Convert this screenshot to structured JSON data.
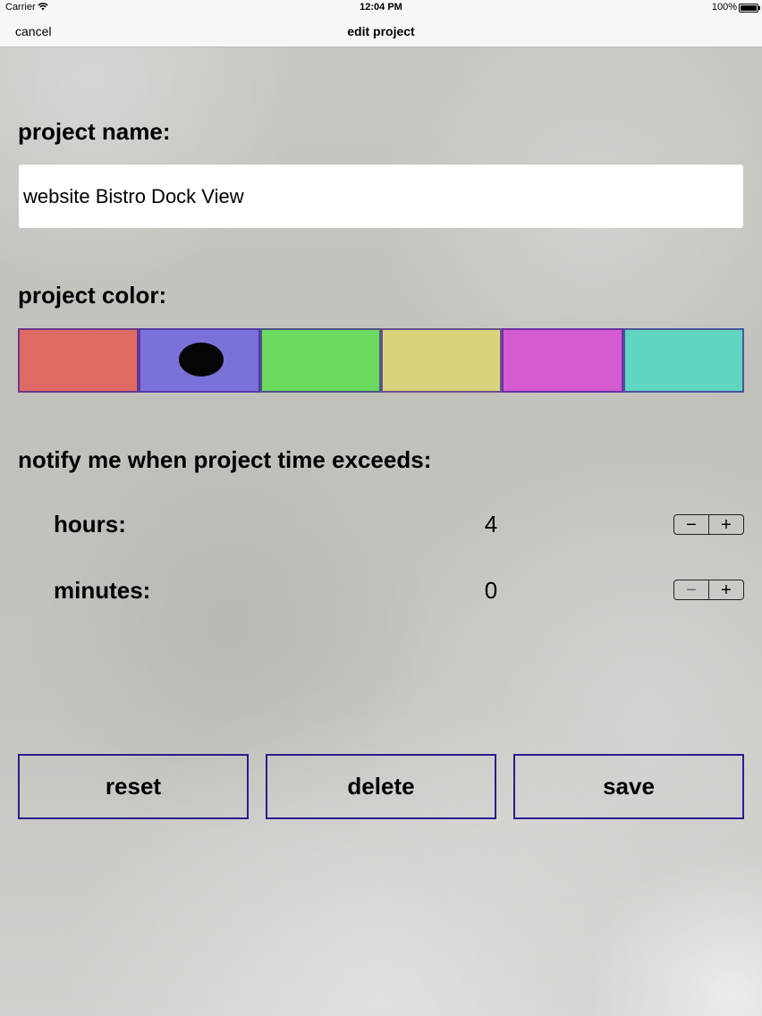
{
  "status_bar": {
    "carrier": "Carrier",
    "wifi_icon": "wifi-icon",
    "time": "12:04 PM",
    "battery_percent": "100%",
    "battery_icon": "battery-icon",
    "battery_level": 1.0
  },
  "nav": {
    "cancel_label": "cancel",
    "title": "edit project"
  },
  "project_name": {
    "label": "project name:",
    "value": "website Bistro Dock View"
  },
  "project_color": {
    "label": "project color:",
    "swatches": [
      {
        "color": "#de6a63",
        "selected": false
      },
      {
        "color": "#7b72d9",
        "selected": true
      },
      {
        "color": "#6bda5e",
        "selected": false
      },
      {
        "color": "#d9d47c",
        "selected": false
      },
      {
        "color": "#d45ad1",
        "selected": false
      },
      {
        "color": "#5ed6c0",
        "selected": false
      }
    ]
  },
  "notify": {
    "label": "notify me when project time exceeds:",
    "hours": {
      "label": "hours:",
      "value": "4",
      "minus": "−",
      "plus": "+"
    },
    "minutes": {
      "label": "minutes:",
      "value": "0",
      "minus": "−",
      "plus": "+"
    }
  },
  "actions": {
    "reset_label": "reset",
    "delete_label": "delete",
    "save_label": "save"
  },
  "colors": {
    "button_border": "#2a1d8f",
    "bar_background": "#f7f7f7"
  }
}
